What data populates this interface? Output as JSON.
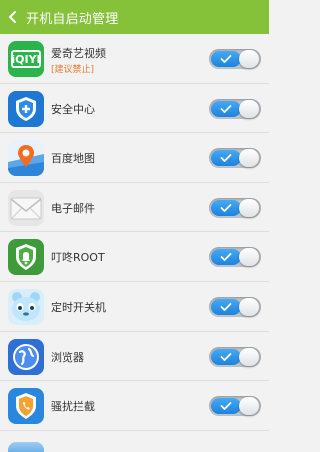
{
  "header": {
    "title": "开机自启动管理"
  },
  "apps": [
    {
      "name": "爱奇艺视频",
      "note": "[建议禁止]",
      "icon": "iqiyi-icon",
      "enabled": true
    },
    {
      "name": "安全中心",
      "note": "",
      "icon": "security-center-icon",
      "enabled": true
    },
    {
      "name": "百度地图",
      "note": "",
      "icon": "baidu-map-icon",
      "enabled": true
    },
    {
      "name": "电子邮件",
      "note": "",
      "icon": "email-icon",
      "enabled": true
    },
    {
      "name": "叮咚ROOT",
      "note": "",
      "icon": "dingdong-root-icon",
      "enabled": true
    },
    {
      "name": "定时开关机",
      "note": "",
      "icon": "scheduled-power-icon",
      "enabled": true
    },
    {
      "name": "浏览器",
      "note": "",
      "icon": "browser-icon",
      "enabled": true
    },
    {
      "name": "骚扰拦截",
      "note": "",
      "icon": "harassment-block-icon",
      "enabled": true
    }
  ],
  "colors": {
    "header": "#85c23a",
    "toggle_on": "#2b90e6",
    "note": "#e87a2d"
  }
}
